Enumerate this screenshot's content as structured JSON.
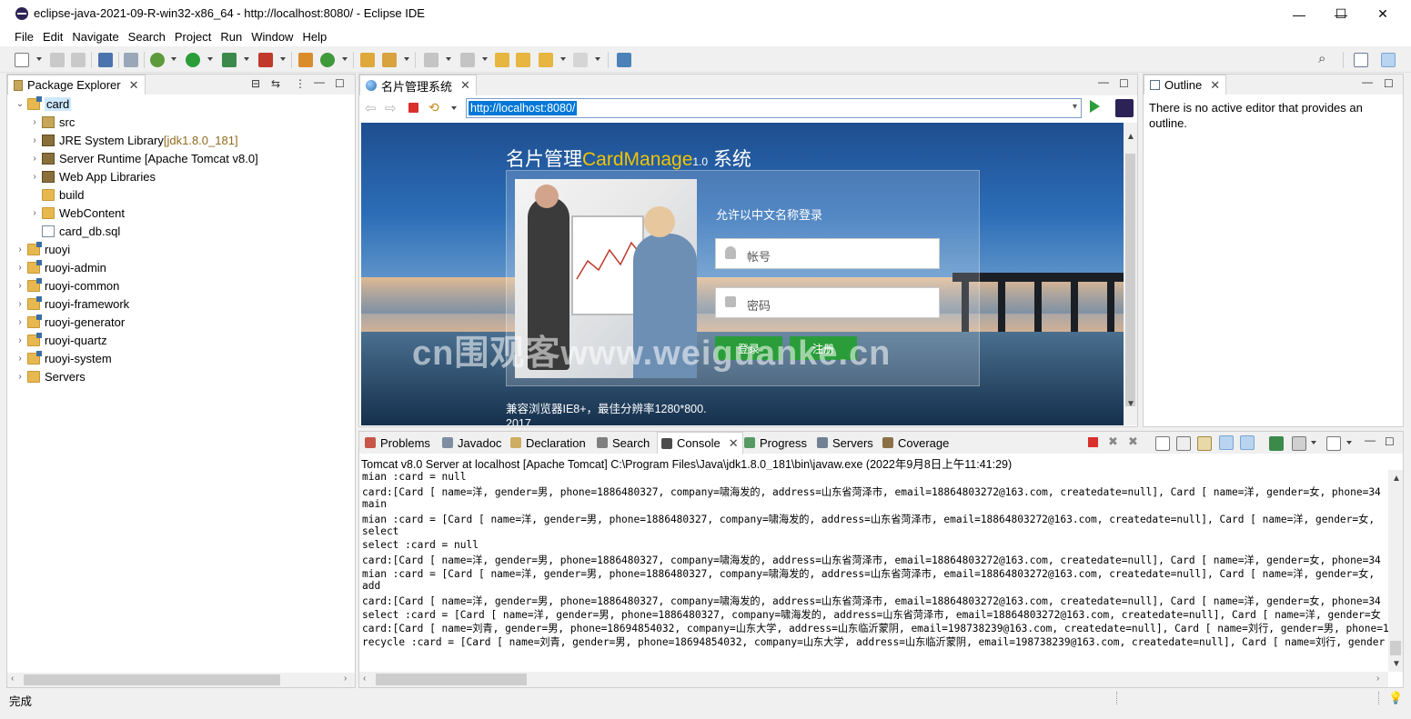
{
  "window": {
    "title": "eclipse-java-2021-09-R-win32-x86_64 - http://localhost:8080/ - Eclipse IDE",
    "minimize": "—",
    "maximize": "☐",
    "close": "✕"
  },
  "menu": [
    "File",
    "Edit",
    "Navigate",
    "Search",
    "Project",
    "Run",
    "Window",
    "Help"
  ],
  "package_explorer": {
    "tab_label": "Package Explorer",
    "items": [
      {
        "label": "card",
        "suffix": "",
        "icon": "project-icon",
        "expanded": true,
        "selected": true
      },
      {
        "label": "src",
        "suffix": "",
        "icon": "package-folder-icon"
      },
      {
        "label": "JRE System Library",
        "suffix": " [jdk1.8.0_181]",
        "icon": "library-icon"
      },
      {
        "label": "Server Runtime [Apache Tomcat v8.0]",
        "suffix": "",
        "icon": "library-icon"
      },
      {
        "label": "Web App Libraries",
        "suffix": "",
        "icon": "library-icon"
      },
      {
        "label": "build",
        "suffix": "",
        "icon": "folder-icon"
      },
      {
        "label": "WebContent",
        "suffix": "",
        "icon": "folder-icon"
      },
      {
        "label": "card_db.sql",
        "suffix": "",
        "icon": "file-icon"
      },
      {
        "label": "ruoyi",
        "suffix": "",
        "icon": "project-icon"
      },
      {
        "label": "ruoyi-admin",
        "suffix": "",
        "icon": "project-icon"
      },
      {
        "label": "ruoyi-common",
        "suffix": "",
        "icon": "project-icon"
      },
      {
        "label": "ruoyi-framework",
        "suffix": "",
        "icon": "project-icon"
      },
      {
        "label": "ruoyi-generator",
        "suffix": "",
        "icon": "project-icon"
      },
      {
        "label": "ruoyi-quartz",
        "suffix": "",
        "icon": "project-icon"
      },
      {
        "label": "ruoyi-system",
        "suffix": "",
        "icon": "project-icon"
      },
      {
        "label": "Servers",
        "suffix": "",
        "icon": "folder-icon"
      }
    ]
  },
  "browser": {
    "tab_label": "名片管理系统",
    "url": "http://localhost:8080/",
    "page": {
      "title_prefix": "名片管理",
      "title_brand": "CardManage",
      "title_version": "1.0",
      "title_suffix": " 系统",
      "hint": "允许以中文名称登录",
      "account_placeholder": "帐号",
      "password_placeholder": "密码",
      "login_button": "登录",
      "register_button": "注册",
      "footer_line1": "兼容浏览器IE8+，最佳分辨率1280*800.",
      "footer_line2": "2017"
    },
    "watermark": "cn围观客www.weiguanke.cn"
  },
  "outline": {
    "tab_label": "Outline",
    "message": "There is no active editor that provides an outline."
  },
  "bottom_tabs": [
    {
      "label": "Problems",
      "icon": "problems-icon"
    },
    {
      "label": "Javadoc",
      "icon": "javadoc-icon"
    },
    {
      "label": "Declaration",
      "icon": "declaration-icon"
    },
    {
      "label": "Search",
      "icon": "search-icon"
    },
    {
      "label": "Console",
      "icon": "console-icon",
      "active": true
    },
    {
      "label": "Progress",
      "icon": "progress-icon"
    },
    {
      "label": "Servers",
      "icon": "servers-icon"
    },
    {
      "label": "Coverage",
      "icon": "coverage-icon"
    }
  ],
  "console": {
    "header": "Tomcat v8.0 Server at localhost [Apache Tomcat] C:\\Program Files\\Java\\jdk1.8.0_181\\bin\\javaw.exe  (2022年9月8日上午11:41:29)",
    "lines": [
      "mian :card = null",
      "card:[Card [ name=洋, gender=男, phone=1886480327, company=啸海发的, address=山东省菏泽市, email=18864803272@163.com, createdate=null], Card [ name=洋, gender=女, phone=34",
      "main",
      "mian :card = [Card [ name=洋, gender=男, phone=1886480327, company=啸海发的, address=山东省菏泽市, email=18864803272@163.com, createdate=null], Card [ name=洋, gender=女,",
      "select",
      "select :card = null",
      "card:[Card [ name=洋, gender=男, phone=1886480327, company=啸海发的, address=山东省菏泽市, email=18864803272@163.com, createdate=null], Card [ name=洋, gender=女, phone=34",
      "mian :card = [Card [ name=洋, gender=男, phone=1886480327, company=啸海发的, address=山东省菏泽市, email=18864803272@163.com, createdate=null], Card [ name=洋, gender=女,",
      "add",
      "card:[Card [ name=洋, gender=男, phone=1886480327, company=啸海发的, address=山东省菏泽市, email=18864803272@163.com, createdate=null], Card [ name=洋, gender=女, phone=34",
      "select :card = [Card [ name=洋, gender=男, phone=1886480327, company=啸海发的, address=山东省菏泽市, email=18864803272@163.com, createdate=null], Card [ name=洋, gender=女",
      "card:[Card [ name=刘青, gender=男, phone=18694854032, company=山东大学, address=山东临沂蒙阴, email=198738239@163.com, createdate=null], Card [ name=刘行, gender=男, phone=1",
      "recycle :card = [Card [ name=刘青, gender=男, phone=18694854032, company=山东大学, address=山东临沂蒙阴, email=198738239@163.com, createdate=null], Card [ name=刘行, gender"
    ]
  },
  "status": {
    "text": "完成"
  },
  "colors": {
    "console_stop": "#d9302c",
    "accent_green": "#2a9d3a",
    "brand_yellow": "#f2c400",
    "selection": "#cde8ff"
  }
}
